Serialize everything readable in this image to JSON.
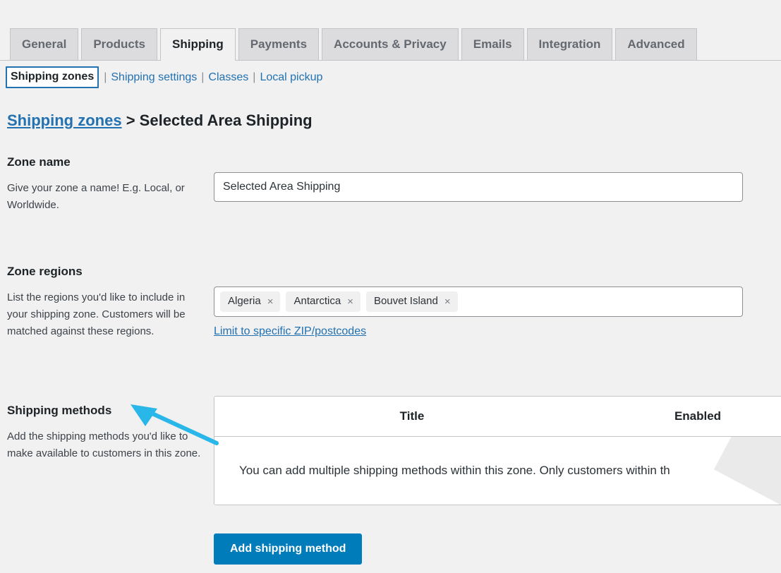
{
  "tabs": [
    {
      "label": "General",
      "active": false
    },
    {
      "label": "Products",
      "active": false
    },
    {
      "label": "Shipping",
      "active": true
    },
    {
      "label": "Payments",
      "active": false
    },
    {
      "label": "Accounts & Privacy",
      "active": false
    },
    {
      "label": "Emails",
      "active": false
    },
    {
      "label": "Integration",
      "active": false
    },
    {
      "label": "Advanced",
      "active": false
    }
  ],
  "subnav": {
    "items": [
      {
        "label": "Shipping zones",
        "current": true
      },
      {
        "label": "Shipping settings",
        "current": false
      },
      {
        "label": "Classes",
        "current": false
      },
      {
        "label": "Local pickup",
        "current": false
      }
    ],
    "separator": "|"
  },
  "breadcrumb": {
    "parent": "Shipping zones",
    "separator": ">",
    "current": "Selected Area Shipping"
  },
  "zone_name": {
    "heading": "Zone name",
    "description": "Give your zone a name! E.g. Local, or Worldwide.",
    "value": "Selected Area Shipping",
    "placeholder": "Zone name"
  },
  "zone_regions": {
    "heading": "Zone regions",
    "description": "List the regions you'd like to include in your shipping zone. Customers will be matched against these regions.",
    "chips": [
      {
        "label": "Algeria",
        "remove_icon": "×"
      },
      {
        "label": "Antarctica",
        "remove_icon": "×"
      },
      {
        "label": "Bouvet Island",
        "remove_icon": "×"
      }
    ],
    "zip_link": "Limit to specific ZIP/postcodes"
  },
  "shipping_methods": {
    "heading": "Shipping methods",
    "description": "Add the shipping methods you'd like to make available to customers in this zone.",
    "columns": {
      "title": "Title",
      "enabled": "Enabled"
    },
    "empty_message": "You can add multiple shipping methods within this zone. Only customers within th",
    "add_button": "Add shipping method"
  },
  "colors": {
    "page_background": "#f1f1f1",
    "link_blue": "#2271b1",
    "primary_button": "#007cba",
    "tab_inactive": "#dcdcde",
    "tab_active": "#f1f1f1",
    "chip_background": "#f0f0f1",
    "border_gray": "#c3c4c7",
    "input_border": "#8c8f94",
    "annotation_arrow": "#29b6e8",
    "text_dark": "#1d2327",
    "text_body": "#3c434a"
  }
}
